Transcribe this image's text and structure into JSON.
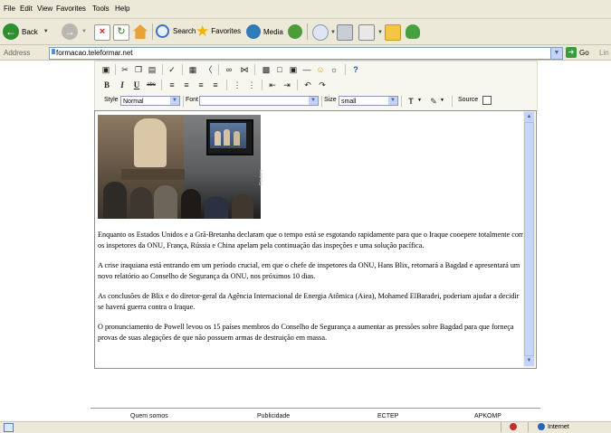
{
  "menu": [
    "File",
    "Edit",
    "View",
    "Favorites",
    "Tools",
    "Help"
  ],
  "toolbar": {
    "back_label": "Back",
    "search_label": "Search",
    "favorites_label": "Favorites",
    "media_label": "Media"
  },
  "address": {
    "label": "Address",
    "url": "formacao.teleformar.net",
    "go_label": "Go",
    "links_label": "Lin"
  },
  "editor_toolbar": {
    "style_label": "Style",
    "style_value": "Normal",
    "font_label": "Font",
    "font_value": "",
    "size_label": "Size",
    "size_value": "small",
    "source_label": "Source"
  },
  "photo_credit": "Reuters",
  "article": [
    "Enquanto os Estados Unidos e a Grã-Bretanha declaram que o tempo está se esgotando rapidamente para que o Iraque cooepere totalmente com os inspetores da ONU, França, Rússia e China apelam pela continuação das inspeções e uma solução pacífica.",
    "A crise iraquiana está entrando em um período crucial, em que o chefe de inspetores da ONU, Hans Blix, retornará a Bagdad e apresentará um novo relatório ao Conselho de Segurança da ONU, nos próximos 10 dias.",
    "As conclusões de Blix e do diretor-geral da Agência Internacional de Energia Atômica (Aiea), Mohamed ElBaradei, poderiam ajudar a decidir se haverá guerra contra o Iraque.",
    "O pronunciamento de Powell levou os 15 países membros do Conselho de Segurança a aumentar as pressões sobre Bagdad para que forneça provas de suas alegações de que não possuem armas de destruição em massa."
  ],
  "footer": [
    "Quem somos",
    "Publicidade",
    "ECTEP",
    "APKOMP"
  ],
  "status": {
    "zone": "Internet"
  },
  "colors": {
    "chrome": "#ece9d8",
    "scroll": "#c7d5fc",
    "go": "#3a9b3a"
  }
}
